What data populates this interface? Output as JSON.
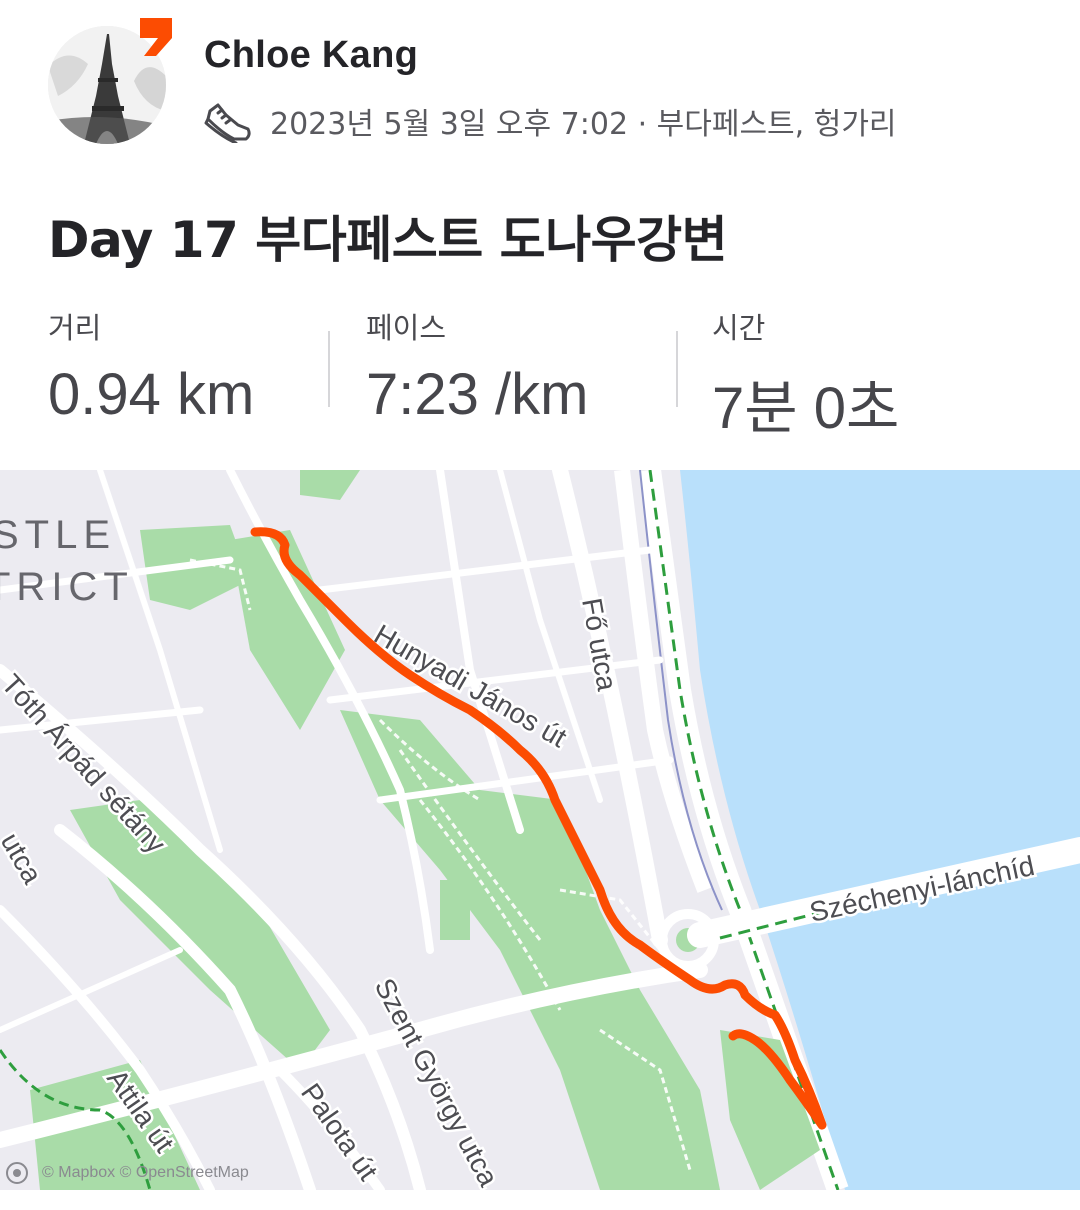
{
  "header": {
    "user_name": "Chloe Kang",
    "activity_meta": "2023년 5월 3일 오후 7:02 · 부다페스트, 헝가리",
    "activity_icon": "running-shoe-icon",
    "brand_color": "#fc4c02"
  },
  "activity": {
    "title": "Day 17 부다페스트 도나우강변"
  },
  "stats": [
    {
      "label": "거리",
      "value": "0.94 km"
    },
    {
      "label": "페이스",
      "value": "7:23 /km"
    },
    {
      "label": "시간",
      "value": "7분 0초"
    }
  ],
  "map": {
    "district_line1": "STLE",
    "district_line2": "TRICT",
    "streets": {
      "fo_utca": "Fő utca",
      "arpad": "Tóth Árpád sétány",
      "utca_fragment": "utca",
      "hunyadi": "Hunyadi János út",
      "szechenyi": "Széchenyi-lánchíd",
      "szent_gyorgy": "Szent György utca",
      "attila": "Attila út",
      "palota": "Palota út"
    },
    "attribution": "© Mapbox © OpenStreetMap",
    "route_color": "#fc4c02",
    "river_color": "#b9e0fb",
    "park_color": "#a9dca8"
  }
}
